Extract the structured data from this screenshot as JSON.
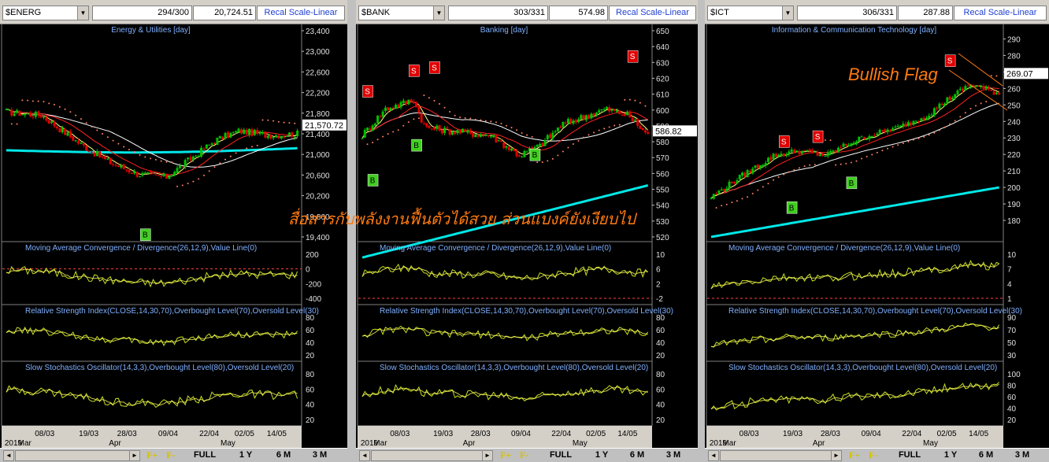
{
  "panels": [
    {
      "symbol": "$ENERG",
      "position": "294/300",
      "value": "20,724.51",
      "recal": "Recal Scale-Linear",
      "title": "Energy & Utilities [day]",
      "last_price": "21,570.72",
      "price_ticks": [
        "23,400",
        "23,000",
        "22,600",
        "22,200",
        "21,800",
        "21,400",
        "21,000",
        "20,600",
        "20,200",
        "19,800",
        "19,400"
      ],
      "price_range": [
        19400,
        23400
      ],
      "signals": [
        {
          "type": "B",
          "label": "B",
          "bar": 52,
          "price": 19450
        }
      ],
      "macd_title": "Moving Average Convergence / Divergence(26,12,9),Value Line(0)",
      "macd_ticks": [
        "200",
        "0",
        "-200",
        "-400"
      ],
      "rsi_title": "Relative Strength Index(CLOSE,14,30,70),Overbought Level(70),Oversold Level(30)",
      "rsi_ticks": [
        "80",
        "60",
        "40",
        "20"
      ],
      "stoch_title": "Slow Stochastics Oscillator(14,3,3),Overbought Level(80),Oversold Level(20)",
      "stoch_ticks": [
        "80",
        "60",
        "40",
        "20"
      ],
      "dates": [
        "08/03",
        "19/03",
        "28/03",
        "09/04",
        "22/04",
        "02/05",
        "14/05"
      ],
      "months": [
        "2019",
        "Mar",
        "Apr",
        "May"
      ]
    },
    {
      "symbol": "$BANK",
      "position": "303/331",
      "value": "574.98",
      "recal": "Recal Scale-Linear",
      "title": "Banking [day]",
      "last_price": "586.82",
      "price_ticks": [
        "650",
        "640",
        "630",
        "620",
        "610",
        "600",
        "590",
        "580",
        "570",
        "560",
        "550",
        "540",
        "530",
        "520"
      ],
      "price_range": [
        520,
        650
      ],
      "signals": [
        {
          "type": "S",
          "label": "S",
          "bar": 2,
          "price": 612
        },
        {
          "type": "B",
          "label": "B",
          "bar": 4,
          "price": 556
        },
        {
          "type": "S",
          "label": "S",
          "bar": 20,
          "price": 625
        },
        {
          "type": "B",
          "label": "B",
          "bar": 21,
          "price": 578
        },
        {
          "type": "S",
          "label": "S",
          "bar": 28,
          "price": 627
        },
        {
          "type": "B",
          "label": "B",
          "bar": 67,
          "price": 572
        },
        {
          "type": "S",
          "label": "S",
          "bar": 105,
          "price": 634
        }
      ],
      "macd_title": "Moving Average Convergence / Divergence(26,12,9),Value Line(0)",
      "macd_ticks": [
        "10",
        "6",
        "2",
        "-2"
      ],
      "rsi_title": "Relative Strength Index(CLOSE,14,30,70),Overbought Level(70),Oversold Level(30)",
      "rsi_ticks": [
        "80",
        "60",
        "40",
        "20"
      ],
      "stoch_title": "Slow Stochastics Oscillator(14,3,3),Overbought Level(80),Oversold Level(20)",
      "stoch_ticks": [
        "80",
        "60",
        "40",
        "20"
      ],
      "dates": [
        "08/03",
        "19/03",
        "28/03",
        "09/04",
        "22/04",
        "02/05",
        "14/05"
      ],
      "months": [
        "2019",
        "Mar",
        "Apr",
        "May"
      ]
    },
    {
      "symbol": "$ICT",
      "position": "306/331",
      "value": "287.88",
      "recal": "Recal Scale-Linear",
      "title": "Information & Communication Technology [day]",
      "last_price": "269.07",
      "price_ticks": [
        "290",
        "280",
        "270",
        "260",
        "250",
        "240",
        "230",
        "220",
        "210",
        "200",
        "190",
        "180"
      ],
      "price_range": [
        170,
        295
      ],
      "signals": [
        {
          "type": "S",
          "label": "S",
          "bar": 28,
          "price": 228
        },
        {
          "type": "B",
          "label": "B",
          "bar": 31,
          "price": 188
        },
        {
          "type": "S",
          "label": "S",
          "bar": 41,
          "price": 231
        },
        {
          "type": "B",
          "label": "B",
          "bar": 54,
          "price": 203
        },
        {
          "type": "S",
          "label": "S",
          "bar": 92,
          "price": 277
        }
      ],
      "macd_title": "Moving Average Convergence / Divergence(26,12,9),Value Line(0)",
      "macd_ticks": [
        "10",
        "7",
        "4",
        "1"
      ],
      "rsi_title": "Relative Strength Index(CLOSE,14,30,70),Overbought Level(70),Oversold Level(30)",
      "rsi_ticks": [
        "90",
        "70",
        "50",
        "30"
      ],
      "stoch_title": "Slow Stochastics Oscillator(14,3,3),Overbought Level(80),Oversold Level(20)",
      "stoch_ticks": [
        "100",
        "80",
        "60",
        "40",
        "20"
      ],
      "dates": [
        "08/03",
        "19/03",
        "28/03",
        "09/04",
        "22/04",
        "02/05",
        "14/05"
      ],
      "months": [
        "2019",
        "Mar",
        "Apr",
        "May"
      ]
    }
  ],
  "bottom_buttons": {
    "f_plus": "F+",
    "f_minus": "F-",
    "full": "FULL",
    "y1": "1 Y",
    "m6": "6 M",
    "m3": "3 M"
  },
  "annotations": {
    "thai_text": "สื่อสารกับพลังงานฟื้นตัวได้สวย ส่วนแบงค์ยังเงียบไป",
    "bullish_flag": "Bullish Flag"
  },
  "colors": {
    "background": "#000000",
    "candle_up": "#00c000",
    "candle_down": "#e00000",
    "ma_short": "#ffff80",
    "ma_mid": "#ff2020",
    "ma_long": "#ffffff",
    "ma_very_long": "#00e8e8",
    "sar": "#ff8060",
    "indicator": "#c8e020",
    "signal_line": "#ffff60",
    "level_line": "#ff4040",
    "title_text": "#7fb0ff",
    "buy_signal": "#40d020",
    "sell_signal": "#e00000",
    "annotation": "#ff7a10"
  }
}
